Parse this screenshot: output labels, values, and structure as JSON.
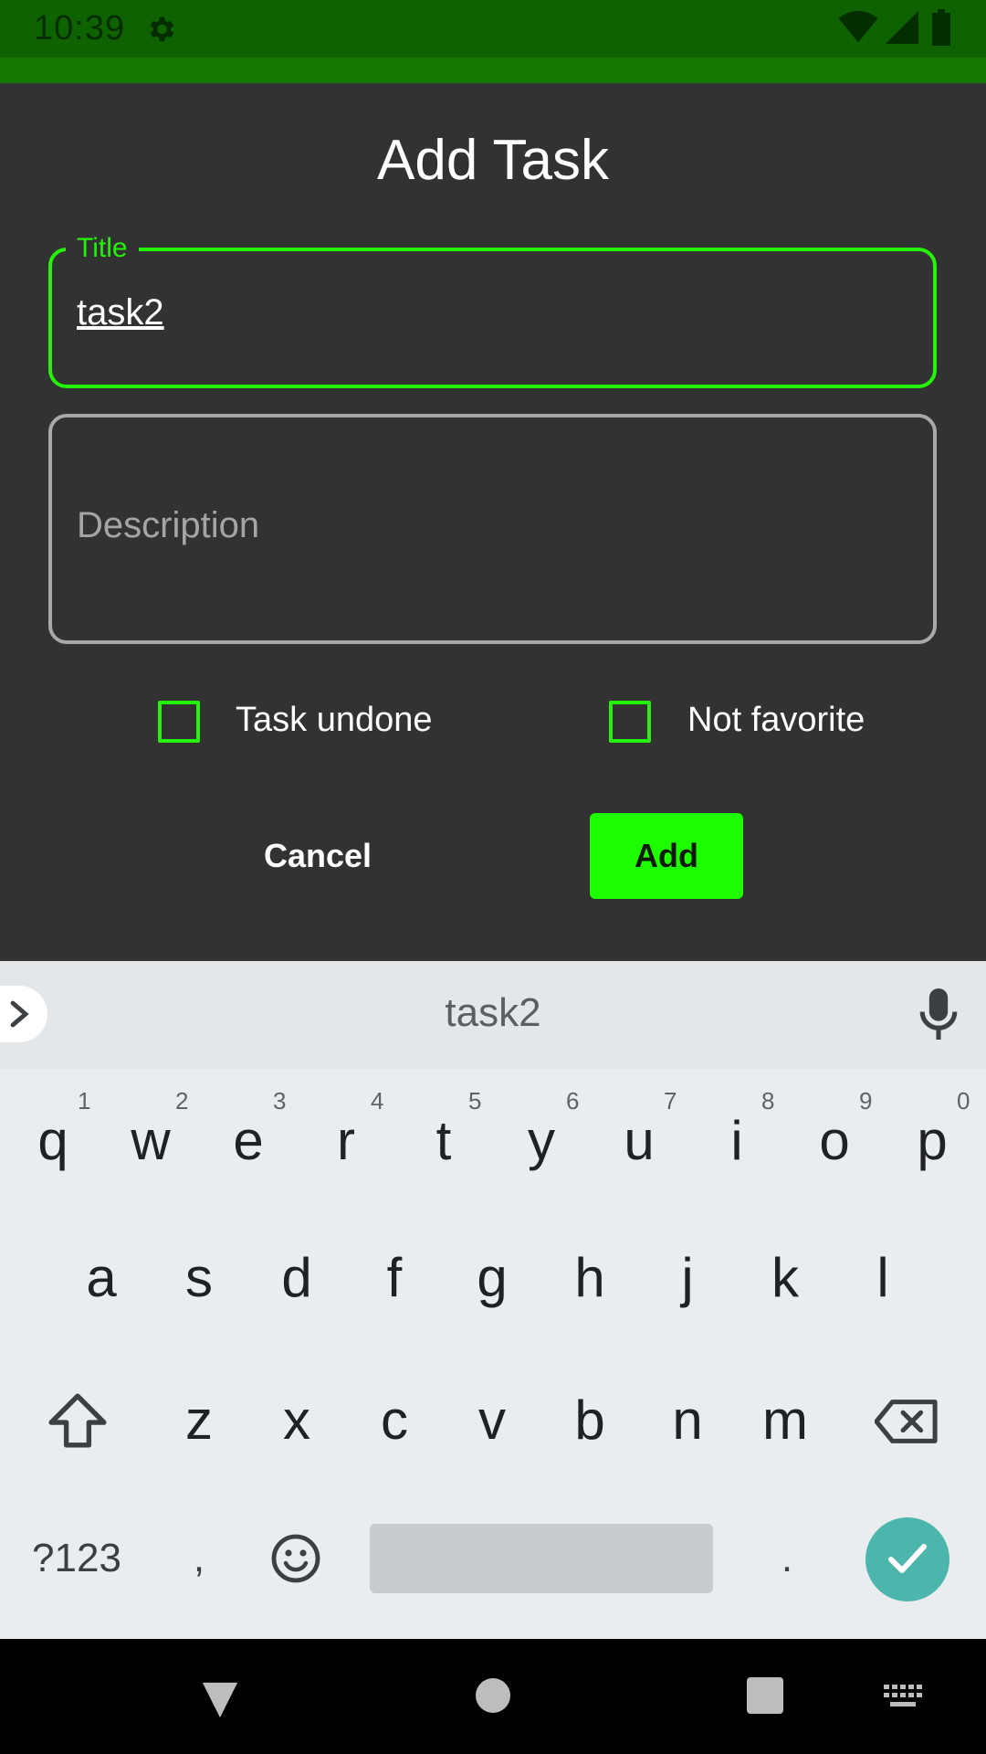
{
  "status_bar": {
    "time": "10:39",
    "icons": [
      "gear-icon",
      "wifi-icon",
      "signal-icon",
      "battery-icon"
    ]
  },
  "dialog": {
    "title": "Add Task",
    "title_field": {
      "label": "Title",
      "value": "task2"
    },
    "description_field": {
      "placeholder": "Description",
      "value": ""
    },
    "checkboxes": [
      {
        "label": "Task undone",
        "checked": false
      },
      {
        "label": "Not favorite",
        "checked": false
      }
    ],
    "buttons": {
      "cancel": "Cancel",
      "add": "Add"
    }
  },
  "keyboard": {
    "suggestion": "task2",
    "row1": [
      "q",
      "w",
      "e",
      "r",
      "t",
      "y",
      "u",
      "i",
      "o",
      "p"
    ],
    "row1_hints": [
      "1",
      "2",
      "3",
      "4",
      "5",
      "6",
      "7",
      "8",
      "9",
      "0"
    ],
    "row2": [
      "a",
      "s",
      "d",
      "f",
      "g",
      "h",
      "j",
      "k",
      "l"
    ],
    "row3": [
      "z",
      "x",
      "c",
      "v",
      "b",
      "n",
      "m"
    ],
    "symbols_key": "?123",
    "comma_key": ",",
    "period_key": "."
  },
  "colors": {
    "accent_green": "#25f20a",
    "add_button": "#1dfc00",
    "status_bar": "#0f6200",
    "dialog_bg": "#323232",
    "enter_key": "#4db6ac"
  }
}
